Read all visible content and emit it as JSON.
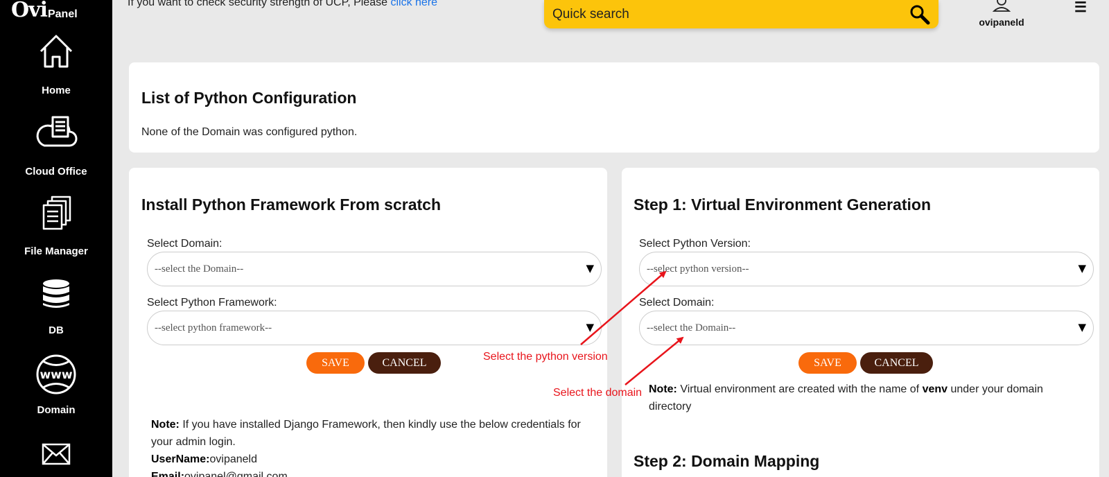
{
  "sidebar": {
    "logo_main": "Ovi",
    "logo_sub": "Panel",
    "items": [
      {
        "label": "Home",
        "icon": "home-icon"
      },
      {
        "label": "Cloud Office",
        "icon": "cloud-office-icon"
      },
      {
        "label": "File Manager",
        "icon": "file-manager-icon"
      },
      {
        "label": "DB",
        "icon": "database-icon"
      },
      {
        "label": "Domain",
        "icon": "www-globe-icon"
      },
      {
        "label": "",
        "icon": "mail-icon"
      }
    ]
  },
  "topbar": {
    "message": "If you want to check security strength of UCP, Please ",
    "message_link": "click here",
    "search_placeholder": "Quick search",
    "username": "ovipaneld"
  },
  "config_list": {
    "title": "List of Python Configuration",
    "empty_text": "None of the Domain was configured python."
  },
  "install": {
    "title": "Install Python Framework From scratch",
    "domain_label": "Select Domain:",
    "domain_value": "--select the Domain--",
    "framework_label": "Select Python Framework:",
    "framework_value": "--select python framework--",
    "save_label": "SAVE",
    "cancel_label": "CANCEL",
    "note_label": "Note:",
    "note_text": " If you have installed Django Framework, then kindly use the below credentials for your admin login.",
    "username_label": "UserName:",
    "username_value": "ovipaneld",
    "email_label": "Email:",
    "email_value": "ovipanel@gmail.com"
  },
  "venv": {
    "title": "Step 1: Virtual Environment Generation",
    "version_label": "Select Python Version:",
    "version_value": "--select python version--",
    "domain_label": "Select Domain:",
    "domain_value": "--select the Domain--",
    "save_label": "SAVE",
    "cancel_label": "CANCEL",
    "note_label": "Note:",
    "note_text_1": " Virtual environment are created with the name of ",
    "note_bold": "venv",
    "note_text_2": " under your domain directory",
    "step2_title": "Step 2: Domain Mapping"
  },
  "annotations": {
    "python_version": "Select the python version",
    "domain": "Select the domain"
  },
  "colors": {
    "sidebar_bg": "#000000",
    "search_bg": "#fcc40b",
    "save_btn": "#f96a0c",
    "cancel_btn": "#4a1f0e",
    "annotation": "#e8141b",
    "link": "#1a73e8"
  }
}
